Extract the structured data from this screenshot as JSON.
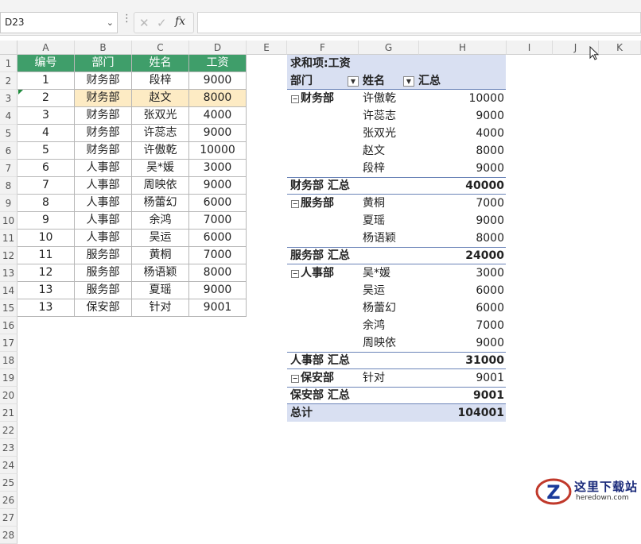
{
  "formula_bar": {
    "name_box": "D23",
    "fx_label": "fx",
    "formula": ""
  },
  "columns": [
    "A",
    "B",
    "C",
    "D",
    "E",
    "F",
    "G",
    "H",
    "I",
    "J",
    "K"
  ],
  "rows": [
    "1",
    "2",
    "3",
    "4",
    "5",
    "6",
    "7",
    "8",
    "9",
    "10",
    "11",
    "12",
    "13",
    "14",
    "15",
    "16",
    "17",
    "18",
    "19",
    "20",
    "21",
    "22",
    "23",
    "24",
    "25",
    "26",
    "27",
    "28"
  ],
  "source_table": {
    "headers": [
      "编号",
      "部门",
      "姓名",
      "工资"
    ],
    "rows": [
      [
        "1",
        "财务部",
        "段梓",
        "9000"
      ],
      [
        "2",
        "财务部",
        "赵文",
        "8000"
      ],
      [
        "3",
        "财务部",
        "张双光",
        "4000"
      ],
      [
        "4",
        "财务部",
        "许蕊志",
        "9000"
      ],
      [
        "5",
        "财务部",
        "许傲乾",
        "10000"
      ],
      [
        "6",
        "人事部",
        "吴*媛",
        "3000"
      ],
      [
        "7",
        "人事部",
        "周映依",
        "9000"
      ],
      [
        "8",
        "人事部",
        "杨蕾幻",
        "6000"
      ],
      [
        "9",
        "人事部",
        "余鸿",
        "7000"
      ],
      [
        "10",
        "人事部",
        "吴运",
        "6000"
      ],
      [
        "11",
        "服务部",
        "黄桐",
        "7000"
      ],
      [
        "12",
        "服务部",
        "杨语颖",
        "8000"
      ],
      [
        "13",
        "服务部",
        "夏瑶",
        "9000"
      ],
      [
        "13",
        "保安部",
        "针对",
        "9001"
      ]
    ]
  },
  "pivot": {
    "title": "求和项:工资",
    "header": {
      "dept": "部门",
      "name": "姓名",
      "total": "汇总"
    },
    "groups": [
      {
        "dept": "财务部",
        "rows": [
          [
            "许傲乾",
            "10000"
          ],
          [
            "许蕊志",
            "9000"
          ],
          [
            "张双光",
            "4000"
          ],
          [
            "赵文",
            "8000"
          ],
          [
            "段梓",
            "9000"
          ]
        ],
        "subtotal_label": "财务部 汇总",
        "subtotal": "40000"
      },
      {
        "dept": "服务部",
        "rows": [
          [
            "黄桐",
            "7000"
          ],
          [
            "夏瑶",
            "9000"
          ],
          [
            "杨语颖",
            "8000"
          ]
        ],
        "subtotal_label": "服务部 汇总",
        "subtotal": "24000"
      },
      {
        "dept": "人事部",
        "rows": [
          [
            "吴*媛",
            "3000"
          ],
          [
            "吴运",
            "6000"
          ],
          [
            "杨蕾幻",
            "6000"
          ],
          [
            "余鸿",
            "7000"
          ],
          [
            "周映依",
            "9000"
          ]
        ],
        "subtotal_label": "人事部 汇总",
        "subtotal": "31000"
      },
      {
        "dept": "保安部",
        "rows": [
          [
            "针对",
            "9001"
          ]
        ],
        "subtotal_label": "保安部 汇总",
        "subtotal": "9001"
      }
    ],
    "grand_total_label": "总计",
    "grand_total": "104001"
  },
  "watermark": {
    "line1": "这里下载站",
    "line2": "heredown.com"
  },
  "colors": {
    "header_green": "#3f9e6a",
    "selected_fill": "#fdebc4",
    "pivot_fill": "#d9e0f2"
  }
}
